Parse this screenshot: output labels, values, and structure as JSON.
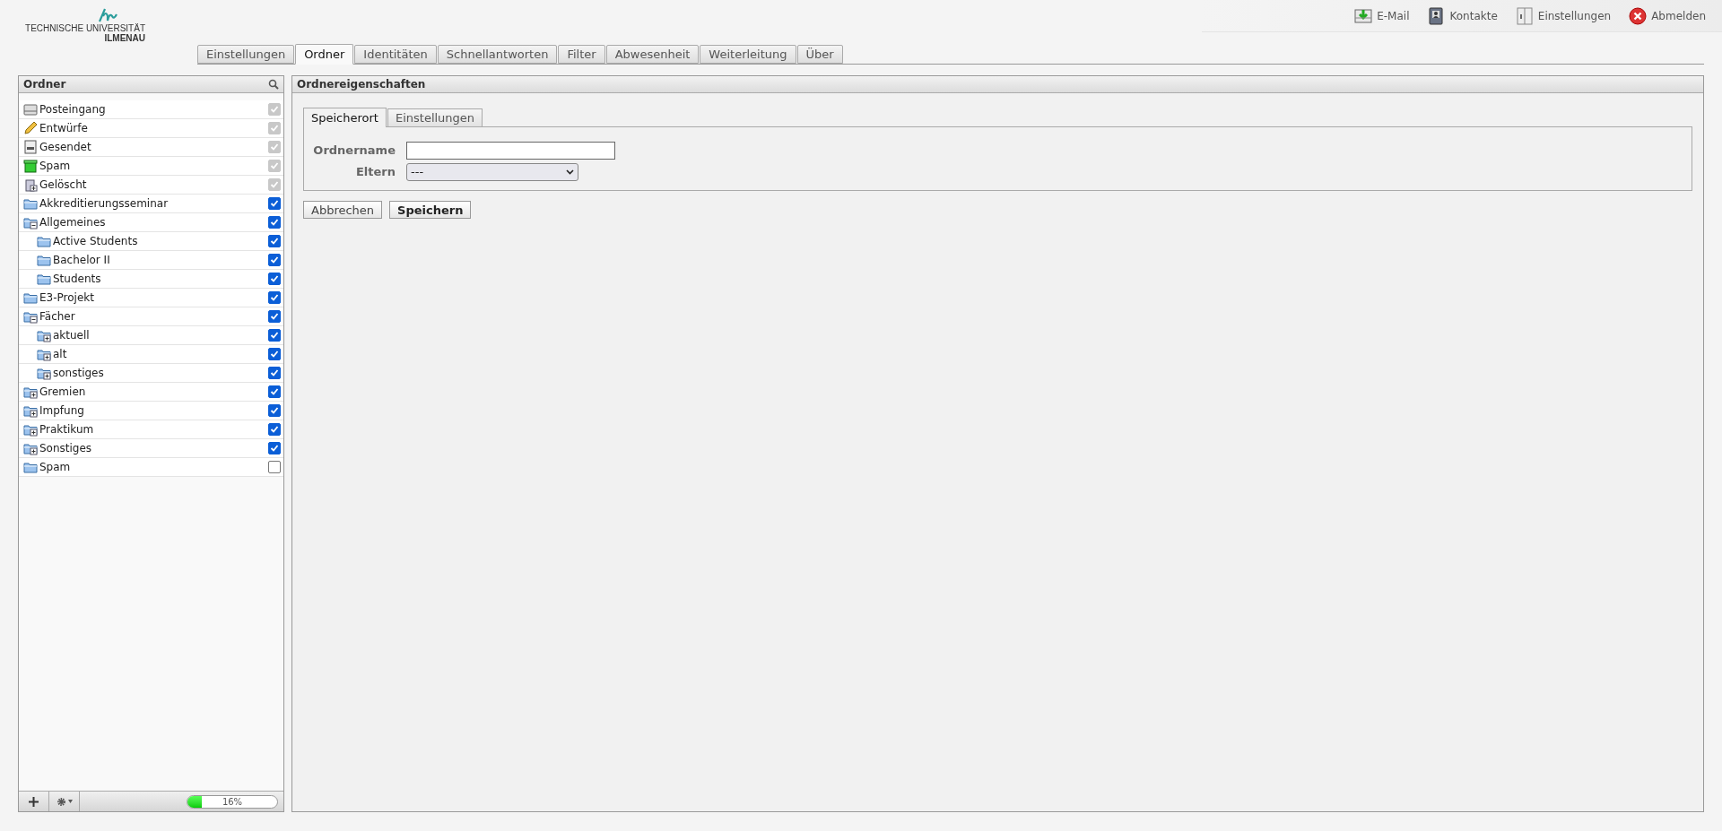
{
  "logo": {
    "line_1": "TECHNISCHE UNIVERSITÄT",
    "line_2": "ILMENAU"
  },
  "top_links": [
    {
      "kind": "mail",
      "label": "E-Mail"
    },
    {
      "kind": "contacts",
      "label": "Kontakte"
    },
    {
      "kind": "settings",
      "label": "Einstellungen"
    },
    {
      "kind": "logout",
      "label": "Abmelden"
    }
  ],
  "tabs": [
    {
      "label": "Einstellungen",
      "selected": false
    },
    {
      "label": "Ordner",
      "selected": true
    },
    {
      "label": "Identitäten",
      "selected": false
    },
    {
      "label": "Schnellantworten",
      "selected": false
    },
    {
      "label": "Filter",
      "selected": false
    },
    {
      "label": "Abwesenheit",
      "selected": false
    },
    {
      "label": "Weiterleitung",
      "selected": false
    },
    {
      "label": "Über",
      "selected": false
    }
  ],
  "folder_panel": {
    "title": "Ordner",
    "folders": [
      {
        "name": "Posteingang",
        "kind": "inbox",
        "checked": true,
        "disabled": true
      },
      {
        "name": "Entwürfe",
        "kind": "drafts",
        "checked": true,
        "disabled": true
      },
      {
        "name": "Gesendet",
        "kind": "sent",
        "checked": true,
        "disabled": true
      },
      {
        "name": "Spam",
        "kind": "junk",
        "checked": true,
        "disabled": true
      },
      {
        "name": "Gelöscht",
        "kind": "trash",
        "checked": true,
        "disabled": true
      },
      {
        "name": "Akkreditierungsseminar",
        "kind": "folder",
        "checked": true,
        "disabled": false
      },
      {
        "name": "Allgemeines",
        "kind": "folder-expanded",
        "checked": true,
        "disabled": false,
        "children": [
          {
            "name": "Active Students",
            "kind": "folder",
            "checked": true,
            "disabled": false
          },
          {
            "name": "Bachelor II",
            "kind": "folder",
            "checked": true,
            "disabled": false
          },
          {
            "name": "Students",
            "kind": "folder",
            "checked": true,
            "disabled": false
          }
        ]
      },
      {
        "name": "E3-Projekt",
        "kind": "folder",
        "checked": true,
        "disabled": false
      },
      {
        "name": "Fächer",
        "kind": "folder-expanded",
        "checked": true,
        "disabled": false,
        "children": [
          {
            "name": "aktuell",
            "kind": "folder-collapsed",
            "checked": true,
            "disabled": false
          },
          {
            "name": "alt",
            "kind": "folder-collapsed",
            "checked": true,
            "disabled": false
          },
          {
            "name": "sonstiges",
            "kind": "folder-collapsed",
            "checked": true,
            "disabled": false
          }
        ]
      },
      {
        "name": "Gremien",
        "kind": "folder-collapsed",
        "checked": true,
        "disabled": false
      },
      {
        "name": "Impfung",
        "kind": "folder-collapsed",
        "checked": true,
        "disabled": false
      },
      {
        "name": "Praktikum",
        "kind": "folder-collapsed",
        "checked": true,
        "disabled": false
      },
      {
        "name": "Sonstiges",
        "kind": "folder-collapsed",
        "checked": true,
        "disabled": false
      },
      {
        "name": "Spam",
        "kind": "folder",
        "checked": false,
        "disabled": false
      }
    ],
    "quota": {
      "level": 0.16,
      "reading": "16%"
    }
  },
  "properties": {
    "title": "Ordnereigenschaften",
    "tabs": [
      {
        "label": "Speicherort",
        "selected": true
      },
      {
        "label": "Einstellungen",
        "selected": false
      }
    ],
    "fields": [
      {
        "label": "Ordnername",
        "kind": "text"
      },
      {
        "label": "Eltern",
        "kind": "select",
        "value": "---"
      }
    ],
    "buttons": [
      {
        "label": "Abbrechen",
        "kind": "secondary"
      },
      {
        "label": "Speichern",
        "kind": "primary"
      }
    ]
  }
}
